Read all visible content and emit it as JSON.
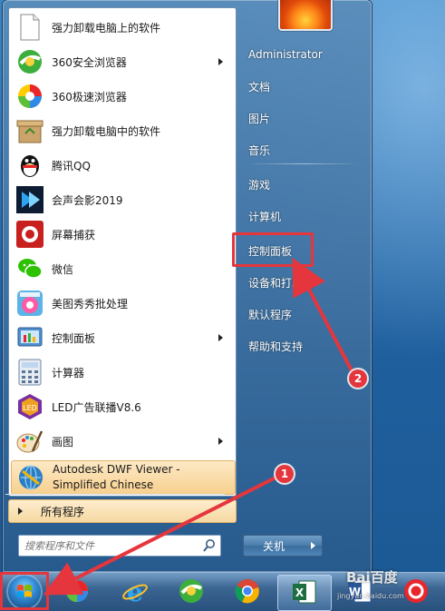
{
  "start_menu": {
    "programs": [
      {
        "label": "强力卸载电脑上的软件",
        "icon": "document-icon",
        "submenu": false
      },
      {
        "label": "360安全浏览器",
        "icon": "360-browser-icon",
        "submenu": true
      },
      {
        "label": "360极速浏览器",
        "icon": "360-speed-browser-icon",
        "submenu": false
      },
      {
        "label": "强力卸载电脑中的软件",
        "icon": "recycle-box-icon",
        "submenu": false
      },
      {
        "label": "腾讯QQ",
        "icon": "qq-penguin-icon",
        "submenu": false
      },
      {
        "label": "会声会影2019",
        "icon": "video-studio-icon",
        "submenu": false
      },
      {
        "label": "屏幕捕获",
        "icon": "screen-capture-icon",
        "submenu": false
      },
      {
        "label": "微信",
        "icon": "wechat-icon",
        "submenu": false
      },
      {
        "label": "美图秀秀批处理",
        "icon": "meitu-icon",
        "submenu": false
      },
      {
        "label": "控制面板",
        "icon": "control-panel-icon",
        "submenu": true
      },
      {
        "label": "计算器",
        "icon": "calculator-icon",
        "submenu": false
      },
      {
        "label": "LED广告联播V8.6",
        "icon": "led-icon",
        "submenu": false
      },
      {
        "label": "画图",
        "icon": "paint-icon",
        "submenu": true
      }
    ],
    "autodesk": {
      "line1": "Autodesk DWF Viewer -",
      "line2": "Simplified Chinese",
      "icon": "autodesk-globe-icon"
    },
    "all_programs": "所有程序",
    "search_placeholder": "搜索程序和文件",
    "right_items": [
      {
        "label": "Administrator"
      },
      {
        "label": "文档"
      },
      {
        "label": "图片"
      },
      {
        "label": "音乐"
      },
      {
        "label": "游戏"
      },
      {
        "label": "计算机"
      },
      {
        "label": "控制面板"
      },
      {
        "label": "设备和打印机"
      },
      {
        "label": "默认程序"
      },
      {
        "label": "帮助和支持"
      }
    ],
    "shutdown": "关机"
  },
  "taskbar": {
    "items": [
      {
        "name": "start-button",
        "icon": "windows-orb-icon"
      },
      {
        "name": "pinwheel-app",
        "icon": "pinwheel-icon"
      },
      {
        "name": "ie-browser",
        "icon": "internet-explorer-icon"
      },
      {
        "name": "360-browser",
        "icon": "360-browser-icon"
      },
      {
        "name": "chrome",
        "icon": "chrome-icon"
      },
      {
        "name": "excel",
        "icon": "excel-icon"
      },
      {
        "name": "word",
        "icon": "word-icon"
      },
      {
        "name": "red-app",
        "icon": "red-app-icon"
      }
    ]
  },
  "annotations": {
    "badge1": "1",
    "badge2": "2",
    "highlight_color": "#e5363d"
  },
  "watermark": {
    "text": "Bai百度",
    "url": "jingyan.baidu.com"
  }
}
